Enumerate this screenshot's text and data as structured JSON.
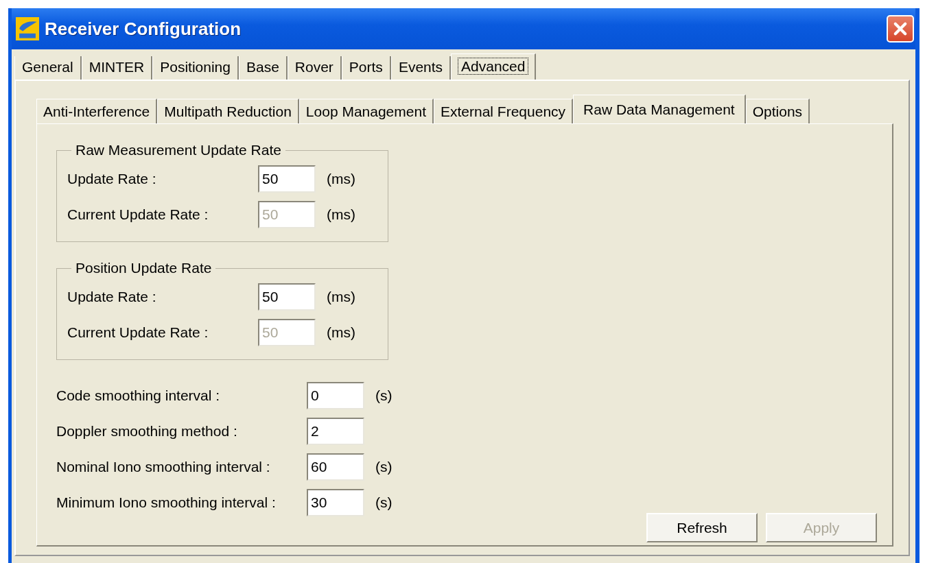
{
  "window": {
    "title": "Receiver Configuration"
  },
  "tabs": [
    {
      "label": "General",
      "selected": false
    },
    {
      "label": "MINTER",
      "selected": false
    },
    {
      "label": "Positioning",
      "selected": false
    },
    {
      "label": "Base",
      "selected": false
    },
    {
      "label": "Rover",
      "selected": false
    },
    {
      "label": "Ports",
      "selected": false
    },
    {
      "label": "Events",
      "selected": false
    },
    {
      "label": "Advanced",
      "selected": true
    }
  ],
  "subtabs": [
    {
      "label": "Anti-Interference",
      "selected": false
    },
    {
      "label": "Multipath Reduction",
      "selected": false
    },
    {
      "label": "Loop Management",
      "selected": false
    },
    {
      "label": "External Frequency",
      "selected": false
    },
    {
      "label": "Raw Data Management",
      "selected": true
    },
    {
      "label": "Options",
      "selected": false
    }
  ],
  "groups": [
    {
      "title": "Raw Measurement Update Rate",
      "rows": [
        {
          "label": "Update Rate :",
          "value": "50",
          "unit": "(ms)",
          "disabled": false
        },
        {
          "label": "Current Update Rate :",
          "value": "50",
          "unit": "(ms)",
          "disabled": true
        }
      ]
    },
    {
      "title": "Position Update Rate",
      "rows": [
        {
          "label": "Update Rate :",
          "value": "50",
          "unit": "(ms)",
          "disabled": false
        },
        {
          "label": "Current Update Rate :",
          "value": "50",
          "unit": "(ms)",
          "disabled": true
        }
      ]
    }
  ],
  "settings": [
    {
      "label": "Code smoothing interval :",
      "value": "0",
      "unit": "(s)"
    },
    {
      "label": "Doppler smoothing method :",
      "value": "2"
    },
    {
      "label": "Nominal Iono smoothing interval :",
      "value": "60",
      "unit": "(s)"
    },
    {
      "label": "Minimum Iono smoothing interval :",
      "value": "30",
      "unit": "(s)"
    }
  ],
  "buttons": [
    {
      "label": "Refresh",
      "disabled": false
    },
    {
      "label": "Apply",
      "disabled": true
    }
  ]
}
